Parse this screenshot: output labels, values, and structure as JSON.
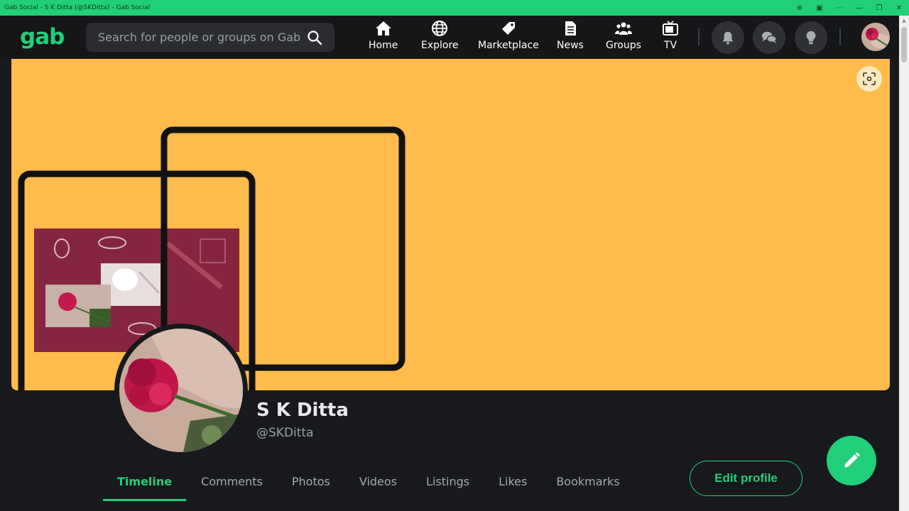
{
  "window": {
    "title": "Gab Social - S K Ditta (@SKDitta) - Gab Social"
  },
  "nav": {
    "logo": "gab",
    "search_placeholder": "Search for people or groups on Gab",
    "items": [
      {
        "label": "Home",
        "icon": "home-icon"
      },
      {
        "label": "Explore",
        "icon": "globe-icon"
      },
      {
        "label": "Marketplace",
        "icon": "tag-icon"
      },
      {
        "label": "News",
        "icon": "document-icon"
      },
      {
        "label": "Groups",
        "icon": "groups-icon"
      },
      {
        "label": "TV",
        "icon": "tv-icon"
      }
    ],
    "actions": [
      "bell-icon",
      "chat-icon",
      "lightbulb-icon"
    ]
  },
  "profile": {
    "name": "S K Ditta",
    "handle": "@SKDitta"
  },
  "tabs": [
    {
      "label": "Timeline",
      "active": true
    },
    {
      "label": "Comments"
    },
    {
      "label": "Photos"
    },
    {
      "label": "Videos"
    },
    {
      "label": "Listings"
    },
    {
      "label": "Likes"
    },
    {
      "label": "Bookmarks"
    }
  ],
  "buttons": {
    "edit_profile": "Edit profile"
  },
  "colors": {
    "brand": "#21cf7a",
    "background": "#17191c",
    "cover": "#ffbb4b"
  }
}
